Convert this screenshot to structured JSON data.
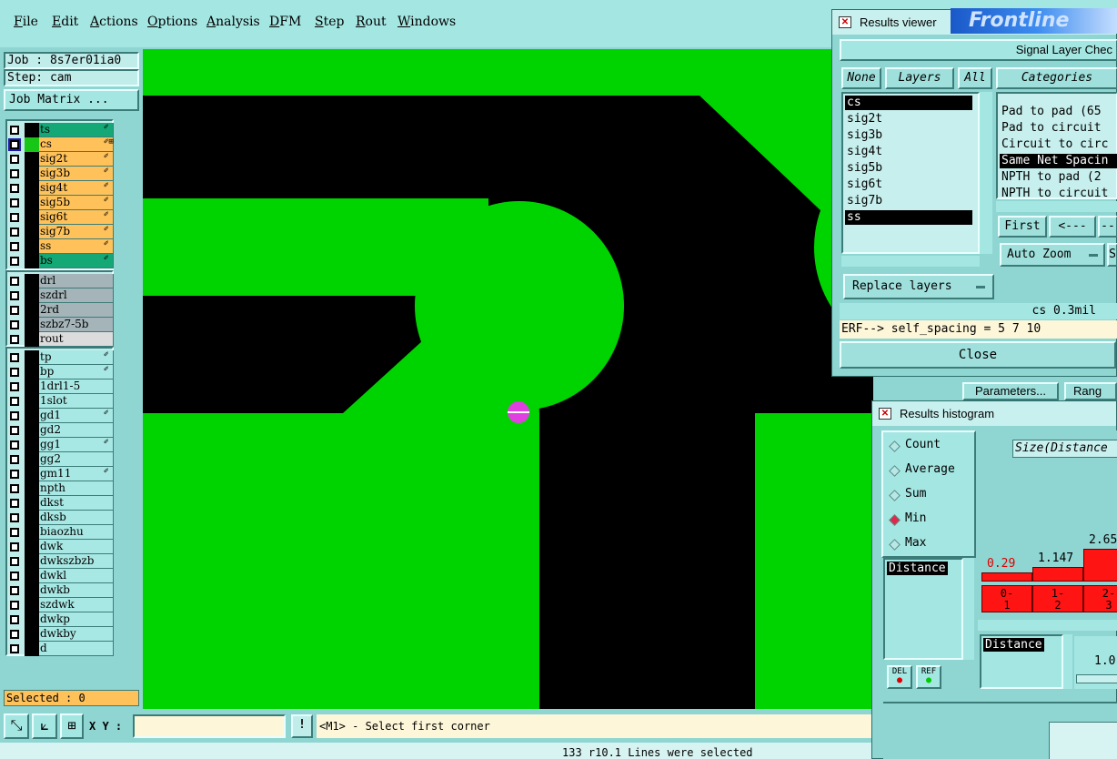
{
  "menu": [
    "File",
    "Edit",
    "Actions",
    "Options",
    "Analysis",
    "DFM",
    "Step",
    "Rout",
    "Windows"
  ],
  "job": {
    "job_label": "Job : 8s7er01ia0",
    "step_label": "Step: cam",
    "matrix_button": "Job Matrix ..."
  },
  "layers_group1": [
    {
      "name": "ts",
      "color": "#15a877",
      "flag": "✐"
    },
    {
      "name": "cs",
      "color": "#ffc25a",
      "flag": "✐⊞",
      "selected": true
    },
    {
      "name": "sig2t",
      "color": "#ffc25a",
      "flag": "✐"
    },
    {
      "name": "sig3b",
      "color": "#ffc25a",
      "flag": "✐"
    },
    {
      "name": "sig4t",
      "color": "#ffc25a",
      "flag": "✐"
    },
    {
      "name": "sig5b",
      "color": "#ffc25a",
      "flag": "✐"
    },
    {
      "name": "sig6t",
      "color": "#ffc25a",
      "flag": "✐"
    },
    {
      "name": "sig7b",
      "color": "#ffc25a",
      "flag": "✐"
    },
    {
      "name": "ss",
      "color": "#ffc25a",
      "flag": "✐"
    },
    {
      "name": "bs",
      "color": "#15a877",
      "flag": "✐"
    }
  ],
  "layers_group2": [
    {
      "name": "drl",
      "color": "#a4b4b8"
    },
    {
      "name": "szdrl",
      "color": "#a4b4b8"
    },
    {
      "name": "2rd",
      "color": "#a4b4b8"
    },
    {
      "name": "szbz7-5b",
      "color": "#a4b4b8"
    },
    {
      "name": "rout",
      "color": "#dcdcdc"
    }
  ],
  "layers_group3": [
    {
      "name": "tp",
      "flag": "✐"
    },
    {
      "name": "bp",
      "flag": "✐"
    },
    {
      "name": "1drl1-5"
    },
    {
      "name": "1slot"
    },
    {
      "name": "gd1",
      "flag": "✐"
    },
    {
      "name": "gd2"
    },
    {
      "name": "gg1",
      "flag": "✐"
    },
    {
      "name": "gg2"
    },
    {
      "name": "gm11",
      "flag": "✐"
    },
    {
      "name": "npth"
    },
    {
      "name": "dkst"
    },
    {
      "name": "dksb"
    },
    {
      "name": "biaozhu"
    },
    {
      "name": "dwk"
    },
    {
      "name": "dwkszbzb"
    },
    {
      "name": "dwkl"
    },
    {
      "name": "dwkb"
    },
    {
      "name": "szdwk"
    },
    {
      "name": "dwkp"
    },
    {
      "name": "dwkby"
    },
    {
      "name": "d"
    }
  ],
  "selected_label": "Selected : 0",
  "bottom": {
    "xy_label": "X Y :",
    "prompt": "<M1> - Select first corner",
    "status": "133 r10.1 Lines were selected",
    "excl": "!"
  },
  "results_viewer": {
    "title": "Results viewer",
    "banner": "Frontline",
    "header": "Signal Layer Chec",
    "none_btn": "None",
    "layers_btn": "Layers",
    "all_btn": "All",
    "categories_btn": "Categories",
    "layers": [
      "cs",
      "sig2t",
      "sig3b",
      "sig4t",
      "sig5b",
      "sig6t",
      "sig7b",
      "ss"
    ],
    "selected_layers": [
      "cs",
      "ss"
    ],
    "categories": [
      "Pad to pad (65",
      "Pad to circuit",
      "Circuit to circ",
      "Same Net Spacin",
      "NPTH to pad (2",
      "NPTH to circuit"
    ],
    "selected_category": "Same Net Spacin",
    "first_btn": "First",
    "prev_btn": "<---",
    "next_btn": "---",
    "autozoom": "Auto Zoom",
    "autozoom_side": "S",
    "replace": "Replace layers",
    "value": "cs 0.3mil",
    "erf": "ERF--> self_spacing = 5 7 10",
    "close": "Close",
    "params_btn": "Parameters...",
    "range_btn": "Rang"
  },
  "histogram": {
    "title": "Results histogram",
    "options": [
      "Count",
      "Average",
      "Sum",
      "Min",
      "Max"
    ],
    "selected_option": "Min",
    "size_label": "Size(Distance",
    "list_item": "Distance",
    "del_btn": "DEL",
    "ref_btn": "REF",
    "bar_labels": [
      "0.29",
      "1.147",
      "2.65"
    ],
    "bar_values": [
      0.29,
      1.147,
      2.65
    ],
    "bins": [
      "0-\n1",
      "1-\n2",
      "2-\n3"
    ],
    "bottom_label": "Distance",
    "bottom_value": "1.0"
  }
}
